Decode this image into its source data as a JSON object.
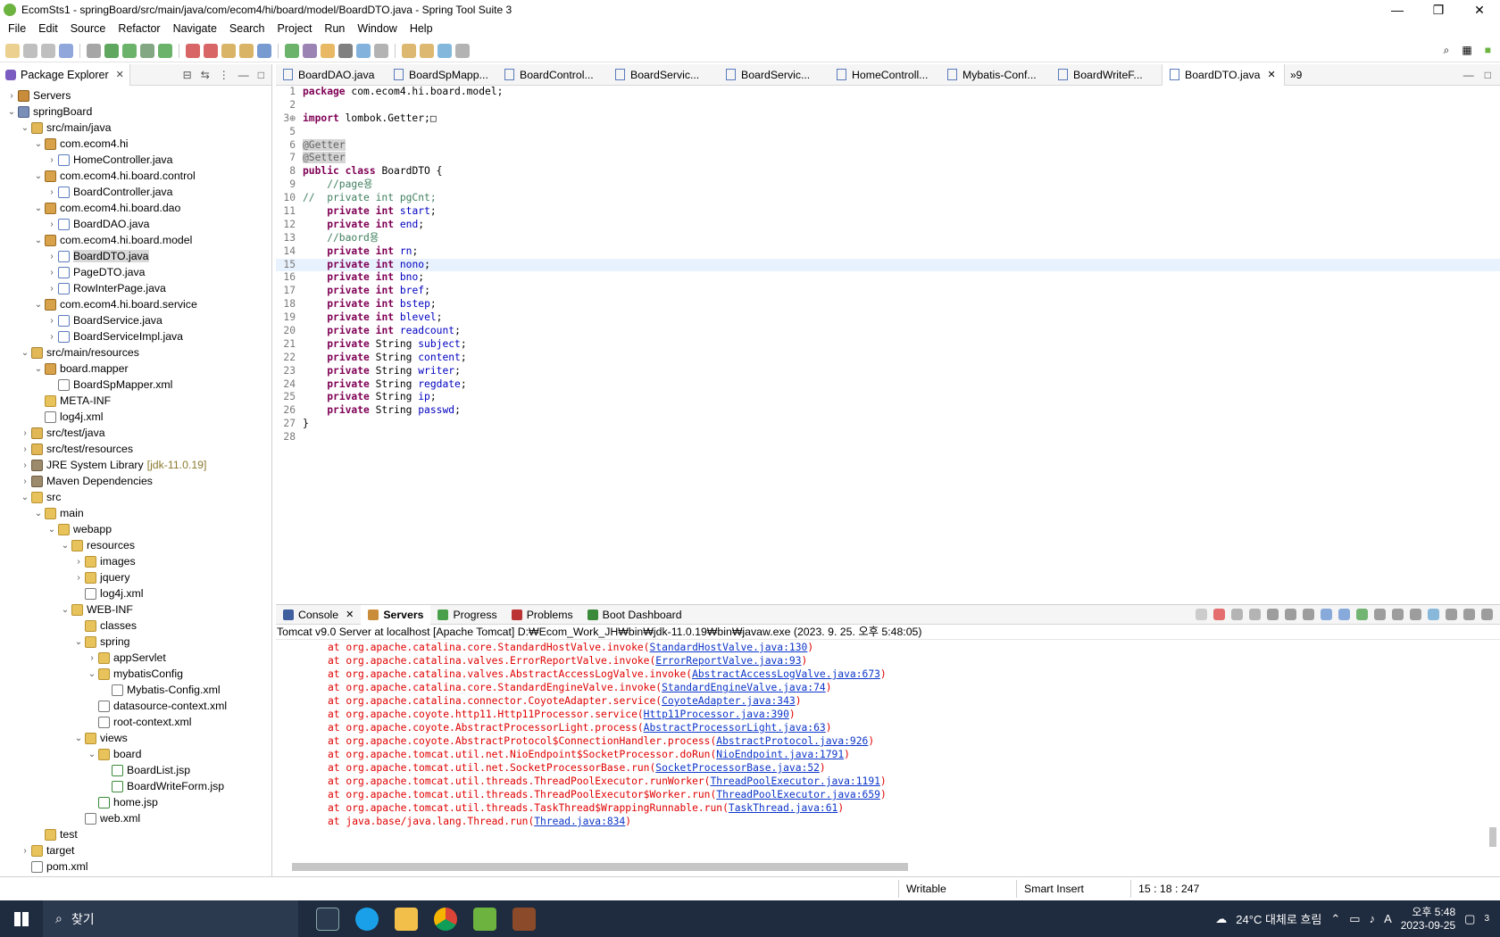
{
  "window": {
    "title": "EcomSts1 - springBoard/src/main/java/com/ecom4/hi/board/model/BoardDTO.java - Spring Tool Suite 3",
    "minimize": "—",
    "maximize": "❐",
    "close": "✕"
  },
  "menu": [
    "File",
    "Edit",
    "Source",
    "Refactor",
    "Navigate",
    "Search",
    "Project",
    "Run",
    "Window",
    "Help"
  ],
  "package_explorer": {
    "tab_label": "Package Explorer",
    "tree": [
      {
        "depth": 0,
        "twisty": ">",
        "icon": "server",
        "label": "Servers"
      },
      {
        "depth": 0,
        "twisty": "v",
        "icon": "project",
        "label": "springBoard"
      },
      {
        "depth": 1,
        "twisty": "v",
        "icon": "srcfolder",
        "label": "src/main/java"
      },
      {
        "depth": 2,
        "twisty": "v",
        "icon": "package",
        "label": "com.ecom4.hi"
      },
      {
        "depth": 3,
        "twisty": ">",
        "icon": "java",
        "label": "HomeController.java"
      },
      {
        "depth": 2,
        "twisty": "v",
        "icon": "package",
        "label": "com.ecom4.hi.board.control"
      },
      {
        "depth": 3,
        "twisty": ">",
        "icon": "java",
        "label": "BoardController.java"
      },
      {
        "depth": 2,
        "twisty": "v",
        "icon": "package",
        "label": "com.ecom4.hi.board.dao"
      },
      {
        "depth": 3,
        "twisty": ">",
        "icon": "java",
        "label": "BoardDAO.java"
      },
      {
        "depth": 2,
        "twisty": "v",
        "icon": "package",
        "label": "com.ecom4.hi.board.model"
      },
      {
        "depth": 3,
        "twisty": ">",
        "icon": "java",
        "label": "BoardDTO.java",
        "selected": true
      },
      {
        "depth": 3,
        "twisty": ">",
        "icon": "java",
        "label": "PageDTO.java"
      },
      {
        "depth": 3,
        "twisty": ">",
        "icon": "java",
        "label": "RowInterPage.java"
      },
      {
        "depth": 2,
        "twisty": "v",
        "icon": "package",
        "label": "com.ecom4.hi.board.service"
      },
      {
        "depth": 3,
        "twisty": ">",
        "icon": "java",
        "label": "BoardService.java"
      },
      {
        "depth": 3,
        "twisty": ">",
        "icon": "java",
        "label": "BoardServiceImpl.java"
      },
      {
        "depth": 1,
        "twisty": "v",
        "icon": "srcfolder",
        "label": "src/main/resources"
      },
      {
        "depth": 2,
        "twisty": "v",
        "icon": "package",
        "label": "board.mapper"
      },
      {
        "depth": 3,
        "twisty": "",
        "icon": "xml",
        "label": "BoardSpMapper.xml"
      },
      {
        "depth": 2,
        "twisty": "",
        "icon": "folder",
        "label": "META-INF"
      },
      {
        "depth": 2,
        "twisty": "",
        "icon": "xml",
        "label": "log4j.xml"
      },
      {
        "depth": 1,
        "twisty": ">",
        "icon": "srcfolder",
        "label": "src/test/java"
      },
      {
        "depth": 1,
        "twisty": ">",
        "icon": "srcfolder",
        "label": "src/test/resources"
      },
      {
        "depth": 1,
        "twisty": ">",
        "icon": "lib",
        "label": "JRE System Library",
        "decor": "[jdk-11.0.19]"
      },
      {
        "depth": 1,
        "twisty": ">",
        "icon": "lib",
        "label": "Maven Dependencies"
      },
      {
        "depth": 1,
        "twisty": "v",
        "icon": "folder",
        "label": "src"
      },
      {
        "depth": 2,
        "twisty": "v",
        "icon": "folder",
        "label": "main"
      },
      {
        "depth": 3,
        "twisty": "v",
        "icon": "folder",
        "label": "webapp"
      },
      {
        "depth": 4,
        "twisty": "v",
        "icon": "folder",
        "label": "resources"
      },
      {
        "depth": 5,
        "twisty": ">",
        "icon": "folder",
        "label": "images"
      },
      {
        "depth": 5,
        "twisty": ">",
        "icon": "folder",
        "label": "jquery"
      },
      {
        "depth": 5,
        "twisty": "",
        "icon": "xml",
        "label": "log4j.xml"
      },
      {
        "depth": 4,
        "twisty": "v",
        "icon": "folder",
        "label": "WEB-INF"
      },
      {
        "depth": 5,
        "twisty": "",
        "icon": "folder",
        "label": "classes"
      },
      {
        "depth": 5,
        "twisty": "v",
        "icon": "folder",
        "label": "spring"
      },
      {
        "depth": 6,
        "twisty": ">",
        "icon": "folder",
        "label": "appServlet"
      },
      {
        "depth": 6,
        "twisty": "v",
        "icon": "folder",
        "label": "mybatisConfig"
      },
      {
        "depth": 7,
        "twisty": "",
        "icon": "xml",
        "label": "Mybatis-Config.xml"
      },
      {
        "depth": 6,
        "twisty": "",
        "icon": "xml",
        "label": "datasource-context.xml"
      },
      {
        "depth": 6,
        "twisty": "",
        "icon": "xml",
        "label": "root-context.xml"
      },
      {
        "depth": 5,
        "twisty": "v",
        "icon": "folder",
        "label": "views"
      },
      {
        "depth": 6,
        "twisty": "v",
        "icon": "folder",
        "label": "board"
      },
      {
        "depth": 7,
        "twisty": "",
        "icon": "jsp",
        "label": "BoardList.jsp"
      },
      {
        "depth": 7,
        "twisty": "",
        "icon": "jsp",
        "label": "BoardWriteForm.jsp"
      },
      {
        "depth": 6,
        "twisty": "",
        "icon": "jsp",
        "label": "home.jsp"
      },
      {
        "depth": 5,
        "twisty": "",
        "icon": "xml",
        "label": "web.xml"
      },
      {
        "depth": 2,
        "twisty": "",
        "icon": "folder",
        "label": "test"
      },
      {
        "depth": 1,
        "twisty": ">",
        "icon": "folder",
        "label": "target"
      },
      {
        "depth": 1,
        "twisty": "",
        "icon": "xml",
        "label": "pom.xml"
      }
    ]
  },
  "editor": {
    "tabs": [
      {
        "label": "BoardDAO.java"
      },
      {
        "label": "BoardSpMapp..."
      },
      {
        "label": "BoardControl..."
      },
      {
        "label": "BoardServic..."
      },
      {
        "label": "BoardServic..."
      },
      {
        "label": "HomeControll..."
      },
      {
        "label": "Mybatis-Conf..."
      },
      {
        "label": "BoardWriteF..."
      },
      {
        "label": "BoardDTO.java",
        "active": true
      }
    ],
    "more_tabs": "»9",
    "lines": [
      {
        "n": "1",
        "text": "package com.ecom4.hi.board.model;"
      },
      {
        "n": "2",
        "text": ""
      },
      {
        "n": "3⊕",
        "text": "import lombok.Getter;□"
      },
      {
        "n": "5",
        "text": ""
      },
      {
        "n": "6",
        "text": "@Getter"
      },
      {
        "n": "7",
        "text": "@Setter"
      },
      {
        "n": "8",
        "text": "public class BoardDTO {"
      },
      {
        "n": "9",
        "text": "    //page용"
      },
      {
        "n": "10",
        "text": "//  private int pgCnt;"
      },
      {
        "n": "11",
        "text": "    private int start;"
      },
      {
        "n": "12",
        "text": "    private int end;"
      },
      {
        "n": "13",
        "text": "    //baord용"
      },
      {
        "n": "14",
        "text": "    private int rn;"
      },
      {
        "n": "15",
        "text": "    private int nono;",
        "current": true
      },
      {
        "n": "16",
        "text": "    private int bno;"
      },
      {
        "n": "17",
        "text": "    private int bref;"
      },
      {
        "n": "18",
        "text": "    private int bstep;"
      },
      {
        "n": "19",
        "text": "    private int blevel;"
      },
      {
        "n": "20",
        "text": "    private int readcount;"
      },
      {
        "n": "21",
        "text": "    private String subject;"
      },
      {
        "n": "22",
        "text": "    private String content;"
      },
      {
        "n": "23",
        "text": "    private String writer;"
      },
      {
        "n": "24",
        "text": "    private String regdate;"
      },
      {
        "n": "25",
        "text": "    private String ip;"
      },
      {
        "n": "26",
        "text": "    private String passwd;"
      },
      {
        "n": "27",
        "text": "}"
      },
      {
        "n": "28",
        "text": ""
      }
    ]
  },
  "console": {
    "tabs": [
      {
        "label": "Console",
        "active": false,
        "close": true,
        "color": "#3f5f9f"
      },
      {
        "label": "Servers",
        "active": true,
        "close": false,
        "color": "#c98c3a"
      },
      {
        "label": "Progress",
        "active": false,
        "close": false,
        "color": "#4aa04a"
      },
      {
        "label": "Problems",
        "active": false,
        "close": false,
        "color": "#b33"
      },
      {
        "label": "Boot Dashboard",
        "active": false,
        "close": false,
        "color": "#3a8a3a"
      }
    ],
    "description": "Tomcat v9.0 Server at localhost [Apache Tomcat] D:₩Ecom_Work_JH₩bin₩jdk-11.0.19₩bin₩javaw.exe  (2023. 9. 25. 오후 5:48:05)",
    "stack": [
      {
        "pre": "at org.apache.catalina.core.StandardHostValve.invoke(",
        "link": "StandardHostValve.java:130",
        "post": ")"
      },
      {
        "pre": "at org.apache.catalina.valves.ErrorReportValve.invoke(",
        "link": "ErrorReportValve.java:93",
        "post": ")"
      },
      {
        "pre": "at org.apache.catalina.valves.AbstractAccessLogValve.invoke(",
        "link": "AbstractAccessLogValve.java:673",
        "post": ")"
      },
      {
        "pre": "at org.apache.catalina.core.StandardEngineValve.invoke(",
        "link": "StandardEngineValve.java:74",
        "post": ")"
      },
      {
        "pre": "at org.apache.catalina.connector.CoyoteAdapter.service(",
        "link": "CoyoteAdapter.java:343",
        "post": ")"
      },
      {
        "pre": "at org.apache.coyote.http11.Http11Processor.service(",
        "link": "Http11Processor.java:390",
        "post": ")"
      },
      {
        "pre": "at org.apache.coyote.AbstractProcessorLight.process(",
        "link": "AbstractProcessorLight.java:63",
        "post": ")"
      },
      {
        "pre": "at org.apache.coyote.AbstractProtocol$ConnectionHandler.process(",
        "link": "AbstractProtocol.java:926",
        "post": ")"
      },
      {
        "pre": "at org.apache.tomcat.util.net.NioEndpoint$SocketProcessor.doRun(",
        "link": "NioEndpoint.java:1791",
        "post": ")"
      },
      {
        "pre": "at org.apache.tomcat.util.net.SocketProcessorBase.run(",
        "link": "SocketProcessorBase.java:52",
        "post": ")"
      },
      {
        "pre": "at org.apache.tomcat.util.threads.ThreadPoolExecutor.runWorker(",
        "link": "ThreadPoolExecutor.java:1191",
        "post": ")"
      },
      {
        "pre": "at org.apache.tomcat.util.threads.ThreadPoolExecutor$Worker.run(",
        "link": "ThreadPoolExecutor.java:659",
        "post": ")"
      },
      {
        "pre": "at org.apache.tomcat.util.threads.TaskThread$WrappingRunnable.run(",
        "link": "TaskThread.java:61",
        "post": ")"
      },
      {
        "pre": "at java.base/java.lang.Thread.run(",
        "link": "Thread.java:834",
        "post": ")"
      }
    ]
  },
  "statusbar": {
    "writable": "Writable",
    "insert_mode": "Smart Insert",
    "position": "15 : 18 : 247"
  },
  "taskbar": {
    "search_placeholder": "찾기",
    "weather": "24°C 대체로 흐림",
    "time": "오후 5:48",
    "date": "2023-09-25",
    "ime": "A",
    "notification_count": "3"
  }
}
